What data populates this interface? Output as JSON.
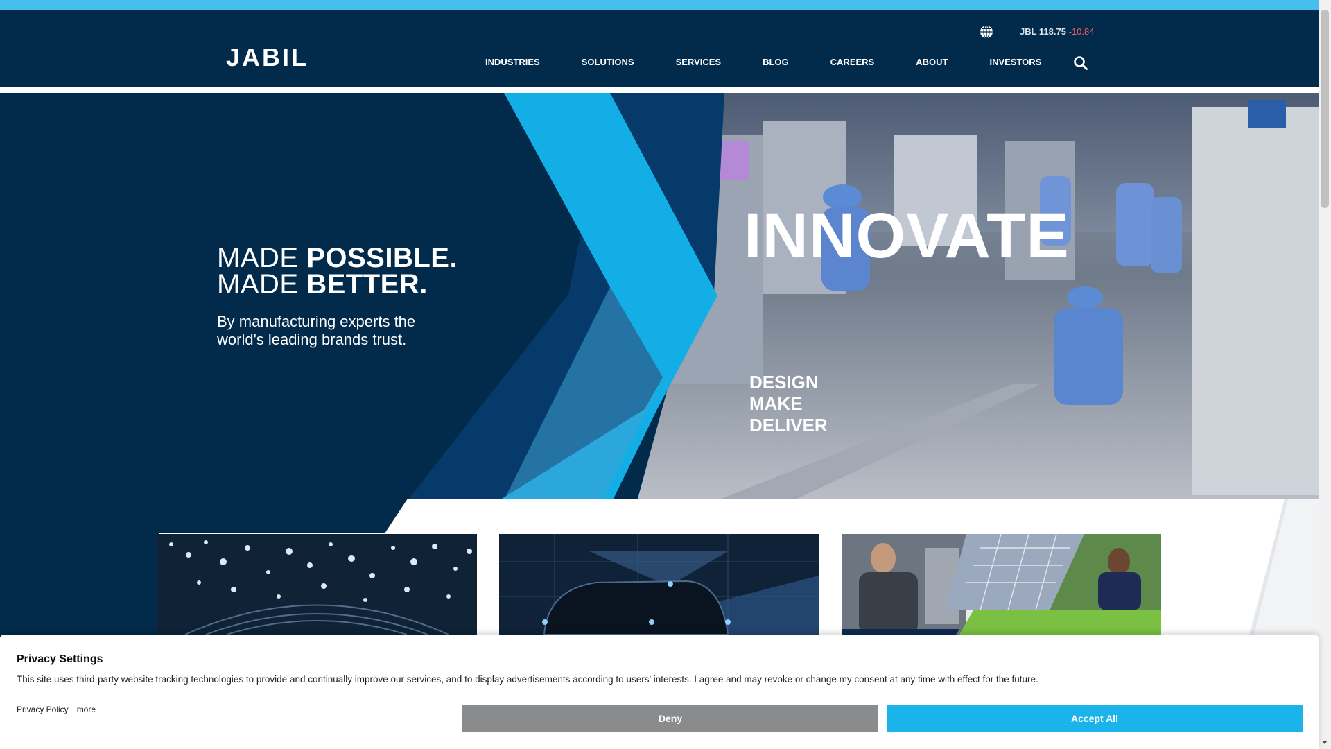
{
  "header": {
    "logo_text": "JABIL",
    "ticker": {
      "symbol_price": "JBL 118.75",
      "change": "-10.84"
    },
    "nav": [
      "INDUSTRIES",
      "SOLUTIONS",
      "SERVICES",
      "BLOG",
      "CAREERS",
      "ABOUT",
      "INVESTORS"
    ],
    "icons": {
      "globe": "globe-icon",
      "search": "search-icon"
    }
  },
  "hero": {
    "line1_thin": "MADE ",
    "line1_bold": "POSSIBLE.",
    "line2_thin": "MADE ",
    "line2_bold": "BETTER.",
    "subtitle": "By manufacturing experts the world's leading brands trust.",
    "headline": "INNOVATE",
    "steps": [
      "DESIGN",
      "MAKE",
      "DELIVER"
    ]
  },
  "consent": {
    "title": "Privacy Settings",
    "text": "This site uses third-party website tracking technologies to provide and continually improve our services, and to display advertisements according to users' interests. I agree and may revoke or change my consent at any time with effect for the future.",
    "links": [
      "Privacy Policy",
      "more"
    ],
    "deny_label": "Deny",
    "accept_label": "Accept All"
  },
  "colors": {
    "navy": "#022a4a",
    "accent_blue": "#1ab3ea",
    "top_strip": "#47bfec",
    "deny_gray": "#8a8b8d"
  }
}
